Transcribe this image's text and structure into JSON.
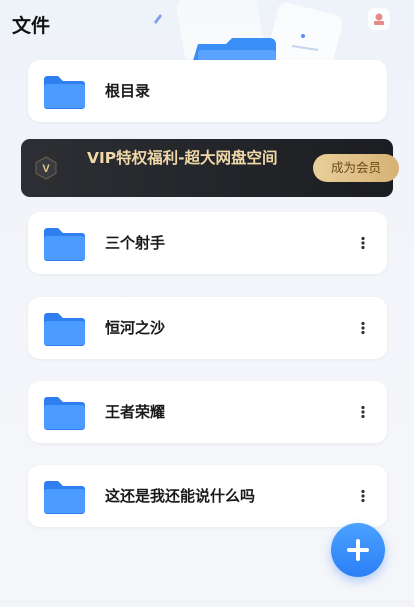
{
  "header": {
    "title": "文件"
  },
  "folders": [
    {
      "name": "根目录",
      "icon": "folder-icon",
      "has_menu": false
    },
    {
      "name": "三个射手",
      "icon": "folder-icon",
      "has_menu": true
    },
    {
      "name": "恒河之沙",
      "icon": "folder-icon",
      "has_menu": true
    },
    {
      "name": "王者荣耀",
      "icon": "folder-icon",
      "has_menu": true
    },
    {
      "name": "这还是我还能说什么吗",
      "icon": "folder-icon",
      "has_menu": true
    }
  ],
  "vip_banner": {
    "badge": "V",
    "text": "VIP特权福利-超大网盘空间",
    "button_label": "成为会员"
  },
  "fab": {
    "icon": "plus-icon"
  },
  "colors": {
    "accent": "#2d7ff6",
    "folder": "#3b8ff0",
    "vip_bg": "#232428",
    "vip_text": "#f0d8a8",
    "vip_button": "#e2c48c"
  }
}
